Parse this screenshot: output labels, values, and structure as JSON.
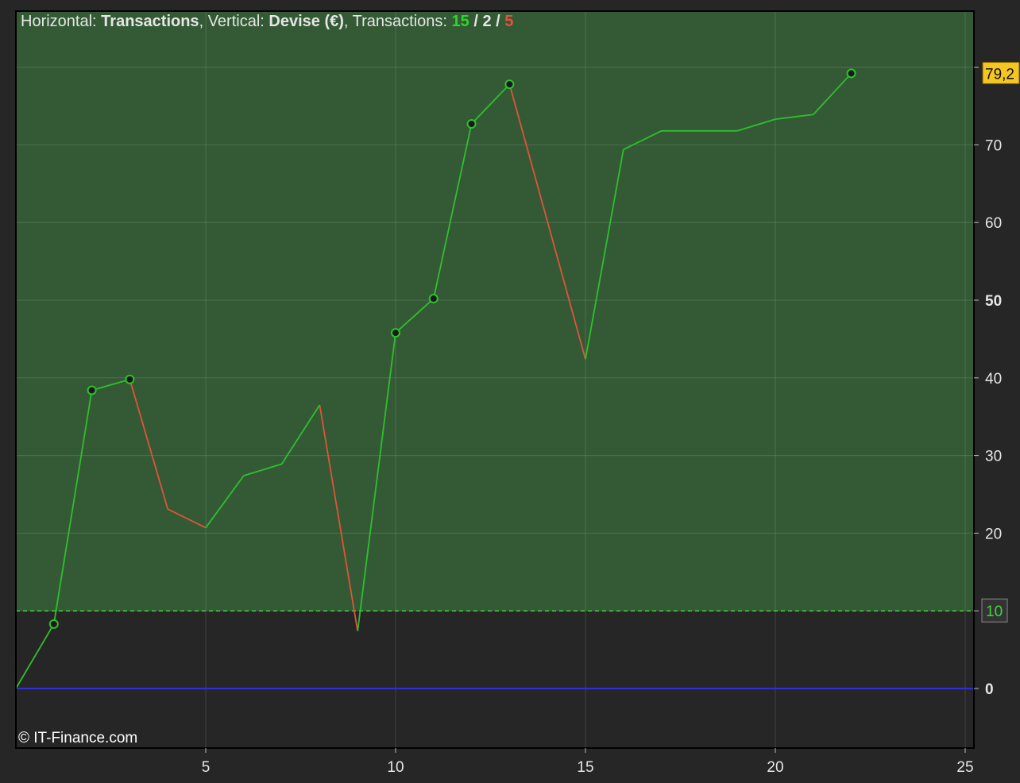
{
  "header": {
    "horizontal_label": "Horizontal:",
    "horizontal_value": "Transactions",
    "vertical_label": "Vertical:",
    "vertical_value": "Devise (€)",
    "transactions_label": "Transactions:",
    "wins": "15",
    "neutral": "2",
    "losses": "5",
    "sep": "/"
  },
  "copyright": "© IT-Finance.com",
  "chart_data": {
    "type": "line",
    "x": [
      0,
      1,
      2,
      3,
      4,
      5,
      6,
      7,
      8,
      9,
      10,
      11,
      12,
      13,
      15,
      16,
      17,
      18,
      19,
      20,
      21,
      22
    ],
    "y": [
      0,
      8.3,
      38.4,
      39.8,
      23.1,
      20.7,
      27.4,
      28.9,
      36.5,
      7.4,
      45.8,
      50.2,
      72.7,
      77.8,
      42.4,
      69.4,
      71.8,
      71.8,
      71.8,
      73.3,
      73.9,
      79.2
    ],
    "markers_at_x": [
      1,
      2,
      3,
      10,
      11,
      12,
      13,
      22
    ],
    "xlim": [
      0,
      25.3
    ],
    "ylim": [
      -7.7,
      87.5
    ],
    "xticks": [
      5,
      10,
      15,
      20,
      25
    ],
    "yticks": [
      0,
      10,
      20,
      30,
      40,
      50,
      60,
      70,
      80
    ],
    "ytick_labels": [
      "0",
      "",
      "20",
      "30",
      "40",
      "50",
      "60",
      "70",
      ""
    ],
    "bold_yticks": [
      0,
      50
    ],
    "threshold": 10,
    "threshold_label": "10",
    "last_value_label": "79,2",
    "grid": true,
    "colors": {
      "up": "#2fbf2f",
      "down": "#e0533c",
      "positive_zone": "#335a35",
      "negative_zone": "#262626",
      "zero_line": "#2f2fd6",
      "threshold": "#3ed63e",
      "last_label_bg": "#f3c623"
    }
  }
}
